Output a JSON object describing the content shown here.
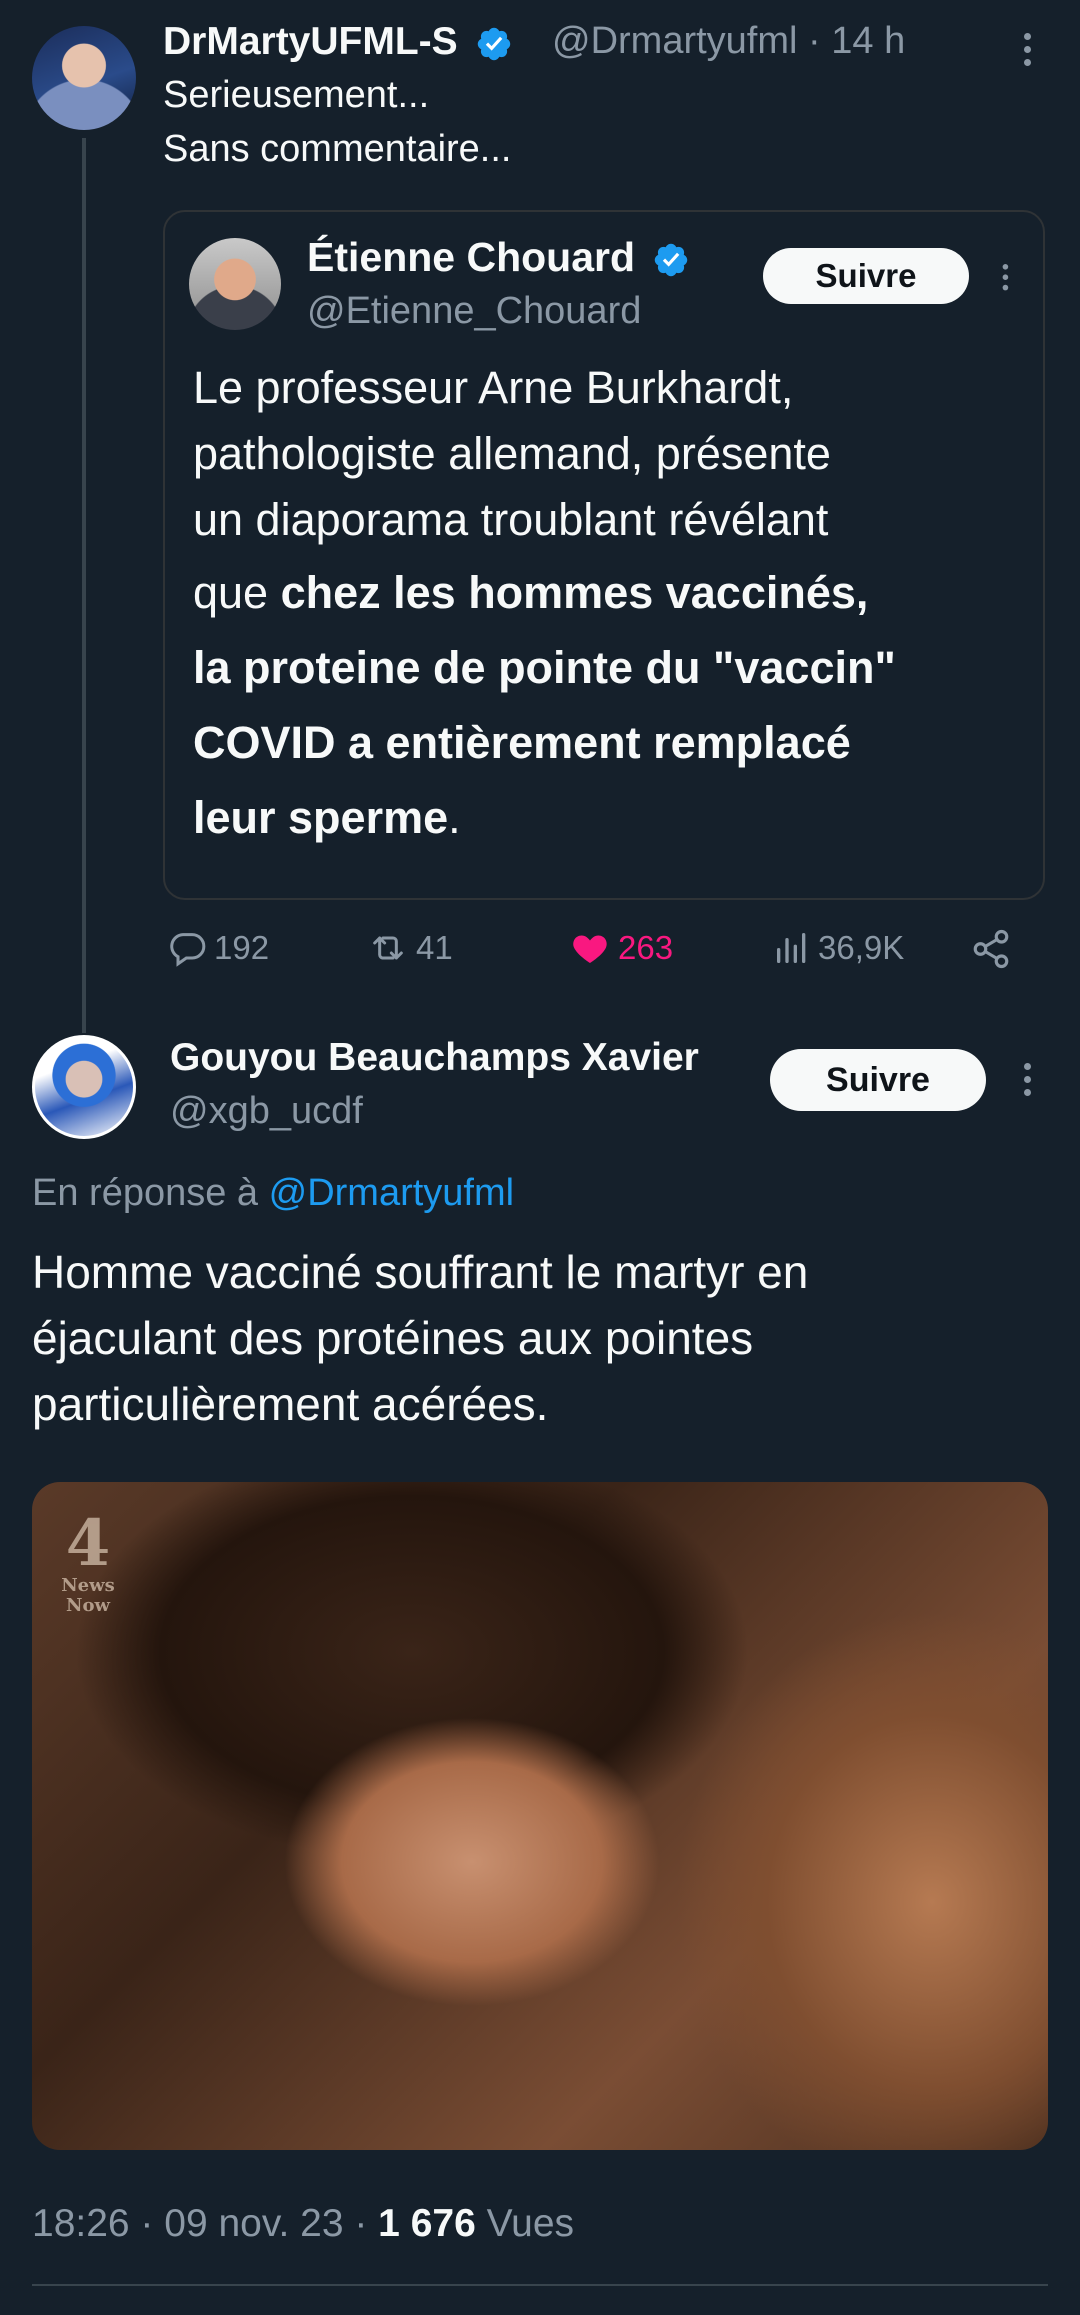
{
  "tweet1": {
    "name": "DrMartyUFML-S",
    "handle": "@Drmartyufml",
    "time": "· 14 h",
    "text_lines": [
      "Serieusement...",
      "Sans commentaire..."
    ],
    "quote": {
      "name": "Étienne Chouard",
      "handle": "@Etienne_Chouard",
      "follow_label": "Suivre",
      "line1": "Le professeur Arne Burkhardt,",
      "line2": "pathologiste allemand, présente",
      "line3": "un diaporama troublant révélant",
      "line4_prefix": "que ",
      "line4_bold": "chez les hommes vaccinés,",
      "line5": "la proteine de pointe du \"vaccin\"",
      "line6": "COVID a entièrement remplacé",
      "line7_bold": "leur sperme",
      "line7_suffix": "."
    },
    "actions": {
      "replies": "192",
      "retweets": "41",
      "likes": "263",
      "views": "36,9K"
    },
    "accent_like": "#f91880"
  },
  "tweet2": {
    "name": "Gouyou Beauchamps Xavier",
    "handle": "@xgb_ucdf",
    "follow_label": "Suivre",
    "reply_prefix": "En réponse à",
    "reply_handle": "@Drmartyufml",
    "text_lines": [
      "Homme vacciné souffrant le martyr en",
      "éjaculant des protéines aux pointes",
      "particulièrement acérées."
    ],
    "media_logo_num": "4",
    "media_logo_text": "News Now",
    "time": "18:26 · 09 nov. 23 · ",
    "views_count": "1 676",
    "views_label": " Vues"
  },
  "colors": {
    "background": "#15202b",
    "link": "#1d9bf0",
    "secondary_text": "#8b98a5",
    "verified": "#1d9bf0"
  }
}
